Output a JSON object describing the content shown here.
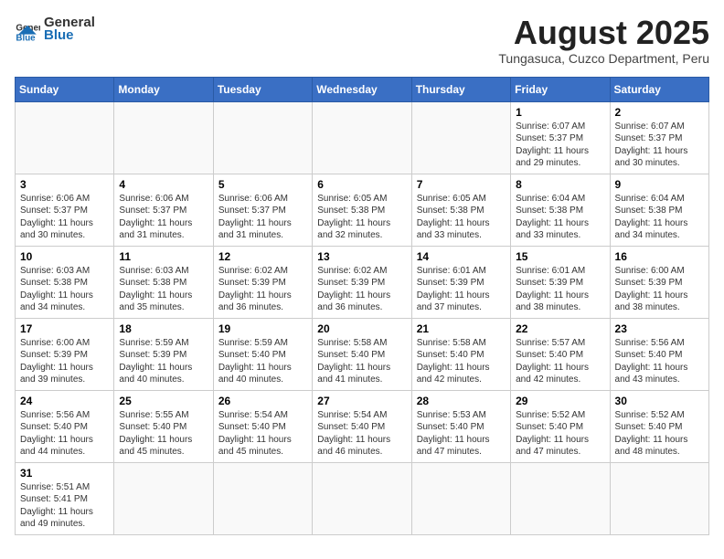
{
  "logo": {
    "text_general": "General",
    "text_blue": "Blue"
  },
  "calendar": {
    "title": "August 2025",
    "subtitle": "Tungasuca, Cuzco Department, Peru",
    "headers": [
      "Sunday",
      "Monday",
      "Tuesday",
      "Wednesday",
      "Thursday",
      "Friday",
      "Saturday"
    ],
    "weeks": [
      [
        {
          "day": "",
          "info": ""
        },
        {
          "day": "",
          "info": ""
        },
        {
          "day": "",
          "info": ""
        },
        {
          "day": "",
          "info": ""
        },
        {
          "day": "",
          "info": ""
        },
        {
          "day": "1",
          "info": "Sunrise: 6:07 AM\nSunset: 5:37 PM\nDaylight: 11 hours\nand 29 minutes."
        },
        {
          "day": "2",
          "info": "Sunrise: 6:07 AM\nSunset: 5:37 PM\nDaylight: 11 hours\nand 30 minutes."
        }
      ],
      [
        {
          "day": "3",
          "info": "Sunrise: 6:06 AM\nSunset: 5:37 PM\nDaylight: 11 hours\nand 30 minutes."
        },
        {
          "day": "4",
          "info": "Sunrise: 6:06 AM\nSunset: 5:37 PM\nDaylight: 11 hours\nand 31 minutes."
        },
        {
          "day": "5",
          "info": "Sunrise: 6:06 AM\nSunset: 5:37 PM\nDaylight: 11 hours\nand 31 minutes."
        },
        {
          "day": "6",
          "info": "Sunrise: 6:05 AM\nSunset: 5:38 PM\nDaylight: 11 hours\nand 32 minutes."
        },
        {
          "day": "7",
          "info": "Sunrise: 6:05 AM\nSunset: 5:38 PM\nDaylight: 11 hours\nand 33 minutes."
        },
        {
          "day": "8",
          "info": "Sunrise: 6:04 AM\nSunset: 5:38 PM\nDaylight: 11 hours\nand 33 minutes."
        },
        {
          "day": "9",
          "info": "Sunrise: 6:04 AM\nSunset: 5:38 PM\nDaylight: 11 hours\nand 34 minutes."
        }
      ],
      [
        {
          "day": "10",
          "info": "Sunrise: 6:03 AM\nSunset: 5:38 PM\nDaylight: 11 hours\nand 34 minutes."
        },
        {
          "day": "11",
          "info": "Sunrise: 6:03 AM\nSunset: 5:38 PM\nDaylight: 11 hours\nand 35 minutes."
        },
        {
          "day": "12",
          "info": "Sunrise: 6:02 AM\nSunset: 5:39 PM\nDaylight: 11 hours\nand 36 minutes."
        },
        {
          "day": "13",
          "info": "Sunrise: 6:02 AM\nSunset: 5:39 PM\nDaylight: 11 hours\nand 36 minutes."
        },
        {
          "day": "14",
          "info": "Sunrise: 6:01 AM\nSunset: 5:39 PM\nDaylight: 11 hours\nand 37 minutes."
        },
        {
          "day": "15",
          "info": "Sunrise: 6:01 AM\nSunset: 5:39 PM\nDaylight: 11 hours\nand 38 minutes."
        },
        {
          "day": "16",
          "info": "Sunrise: 6:00 AM\nSunset: 5:39 PM\nDaylight: 11 hours\nand 38 minutes."
        }
      ],
      [
        {
          "day": "17",
          "info": "Sunrise: 6:00 AM\nSunset: 5:39 PM\nDaylight: 11 hours\nand 39 minutes."
        },
        {
          "day": "18",
          "info": "Sunrise: 5:59 AM\nSunset: 5:39 PM\nDaylight: 11 hours\nand 40 minutes."
        },
        {
          "day": "19",
          "info": "Sunrise: 5:59 AM\nSunset: 5:40 PM\nDaylight: 11 hours\nand 40 minutes."
        },
        {
          "day": "20",
          "info": "Sunrise: 5:58 AM\nSunset: 5:40 PM\nDaylight: 11 hours\nand 41 minutes."
        },
        {
          "day": "21",
          "info": "Sunrise: 5:58 AM\nSunset: 5:40 PM\nDaylight: 11 hours\nand 42 minutes."
        },
        {
          "day": "22",
          "info": "Sunrise: 5:57 AM\nSunset: 5:40 PM\nDaylight: 11 hours\nand 42 minutes."
        },
        {
          "day": "23",
          "info": "Sunrise: 5:56 AM\nSunset: 5:40 PM\nDaylight: 11 hours\nand 43 minutes."
        }
      ],
      [
        {
          "day": "24",
          "info": "Sunrise: 5:56 AM\nSunset: 5:40 PM\nDaylight: 11 hours\nand 44 minutes."
        },
        {
          "day": "25",
          "info": "Sunrise: 5:55 AM\nSunset: 5:40 PM\nDaylight: 11 hours\nand 45 minutes."
        },
        {
          "day": "26",
          "info": "Sunrise: 5:54 AM\nSunset: 5:40 PM\nDaylight: 11 hours\nand 45 minutes."
        },
        {
          "day": "27",
          "info": "Sunrise: 5:54 AM\nSunset: 5:40 PM\nDaylight: 11 hours\nand 46 minutes."
        },
        {
          "day": "28",
          "info": "Sunrise: 5:53 AM\nSunset: 5:40 PM\nDaylight: 11 hours\nand 47 minutes."
        },
        {
          "day": "29",
          "info": "Sunrise: 5:52 AM\nSunset: 5:40 PM\nDaylight: 11 hours\nand 47 minutes."
        },
        {
          "day": "30",
          "info": "Sunrise: 5:52 AM\nSunset: 5:40 PM\nDaylight: 11 hours\nand 48 minutes."
        }
      ],
      [
        {
          "day": "31",
          "info": "Sunrise: 5:51 AM\nSunset: 5:41 PM\nDaylight: 11 hours\nand 49 minutes."
        },
        {
          "day": "",
          "info": ""
        },
        {
          "day": "",
          "info": ""
        },
        {
          "day": "",
          "info": ""
        },
        {
          "day": "",
          "info": ""
        },
        {
          "day": "",
          "info": ""
        },
        {
          "day": "",
          "info": ""
        }
      ]
    ]
  }
}
